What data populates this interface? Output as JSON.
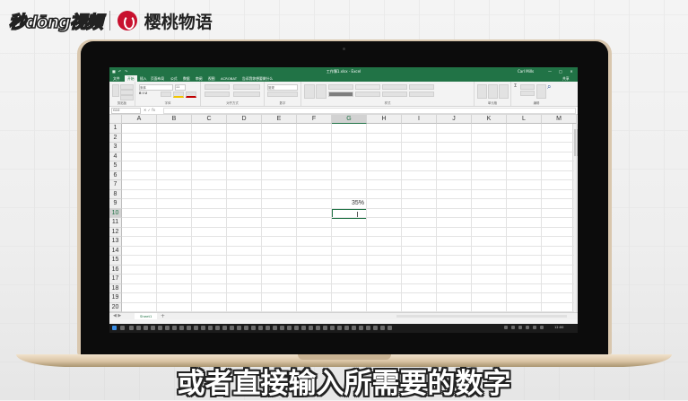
{
  "brand": {
    "left_logo": "秒dōng视频",
    "right_logo": "樱桃物语"
  },
  "excel": {
    "title": "工作簿1.xlsx - Excel",
    "user": "Carl Mills",
    "window_controls": [
      "—",
      "□",
      "✕"
    ],
    "ribbon_tabs": [
      "文件",
      "开始",
      "插入",
      "页面布局",
      "公式",
      "数据",
      "审阅",
      "视图",
      "ACROBAT",
      "告诉我你想要做什么"
    ],
    "active_tab": "开始",
    "share": "共享",
    "ribbon_groups": [
      "剪贴板",
      "字体",
      "对齐方式",
      "数字",
      "样式",
      "单元格",
      "编辑"
    ],
    "font_name": "宋体",
    "font_size": "11",
    "number_format": "常规",
    "name_box": "G10",
    "formula_icons": "✕ ✓ fx",
    "columns": [
      "A",
      "B",
      "C",
      "D",
      "E",
      "F",
      "G",
      "H",
      "I",
      "J",
      "K",
      "L",
      "M"
    ],
    "rows": [
      "1",
      "2",
      "3",
      "4",
      "5",
      "6",
      "7",
      "8",
      "9",
      "10",
      "11",
      "12",
      "13",
      "14",
      "15",
      "16",
      "17",
      "18",
      "19",
      "20"
    ],
    "cell_G9": "35%",
    "sheet_tab": "Sheet1",
    "add_sheet": "+",
    "clock": "12:00"
  },
  "subtitle": "或者直接输入所需要的数字"
}
